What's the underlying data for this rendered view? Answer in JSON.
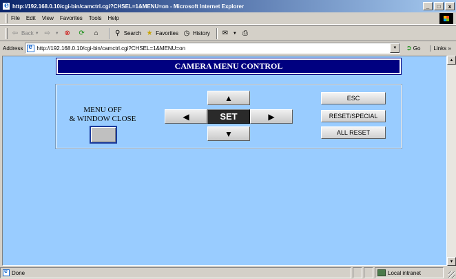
{
  "window": {
    "title": "http://192.168.0.10/cgi-bin/camctrl.cgi?CHSEL=1&MENU=on - Microsoft Internet Explorer",
    "minimize": "_",
    "maximize": "□",
    "close": "x"
  },
  "menubar": {
    "items": [
      "File",
      "Edit",
      "View",
      "Favorites",
      "Tools",
      "Help"
    ]
  },
  "toolbar": {
    "back": "Back",
    "search": "Search",
    "favorites": "Favorites",
    "history": "History"
  },
  "address": {
    "label": "Address",
    "url": "http://192.168.0.10/cgi-bin/camctrl.cgi?CHSEL=1&MENU=on",
    "go": "Go",
    "links": "Links »"
  },
  "page": {
    "header": "CAMERA MENU CONTROL",
    "close_label_line1": "MENU OFF",
    "close_label_line2": "& WINDOW CLOSE",
    "nav": {
      "up": "▲",
      "down": "▼",
      "left": "◀",
      "right": "▶",
      "set": "SET"
    },
    "buttons": {
      "esc": "ESC",
      "reset_special": "RESET/SPECIAL",
      "all_reset": "ALL RESET"
    },
    "colors": {
      "background": "#99ccff",
      "header_bg": "#000080"
    }
  },
  "status": {
    "text": "Done",
    "zone": "Local intranet"
  }
}
